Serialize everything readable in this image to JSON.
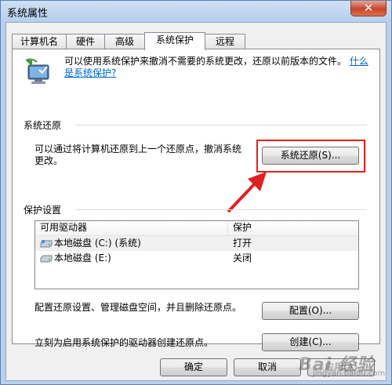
{
  "window": {
    "title": "系统属性",
    "close_glyph": "✕"
  },
  "tabs": [
    {
      "label": "计算机名"
    },
    {
      "label": "硬件"
    },
    {
      "label": "高级"
    },
    {
      "label": "系统保护"
    },
    {
      "label": "远程"
    }
  ],
  "intro": {
    "text": "可以使用系统保护来撤消不需要的系统更改，还原以前版本的文件。",
    "link": "什么是系统保护?"
  },
  "system_restore": {
    "group_label": "系统还原",
    "description": "可以通过将计算机还原到上一个还原点，撤消系统更改。",
    "button_label": "系统还原(S)..."
  },
  "protection": {
    "group_label": "保护设置",
    "columns": [
      "可用驱动器",
      "保护"
    ],
    "drives": [
      {
        "name": "本地磁盘 (C:) (系统)",
        "protection": "打开",
        "icon": "system-drive-icon"
      },
      {
        "name": "本地磁盘 (E:)",
        "protection": "关闭",
        "icon": "drive-icon"
      }
    ],
    "config_text": "配置还原设置、管理磁盘空间，并且删除还原点。",
    "config_button": "配置(O)...",
    "create_text": "立刻为启用系统保护的驱动器创建还原点。",
    "create_button": "创建(C)..."
  },
  "footer": {
    "ok": "确定",
    "cancel": "取消",
    "apply": "应用(A)"
  },
  "watermark": {
    "main": "Bai 经验",
    "sub": "jingyan.baidu.com"
  },
  "colors": {
    "highlight": "#e02020",
    "link": "#0066cc",
    "arrow": "#e02020"
  }
}
